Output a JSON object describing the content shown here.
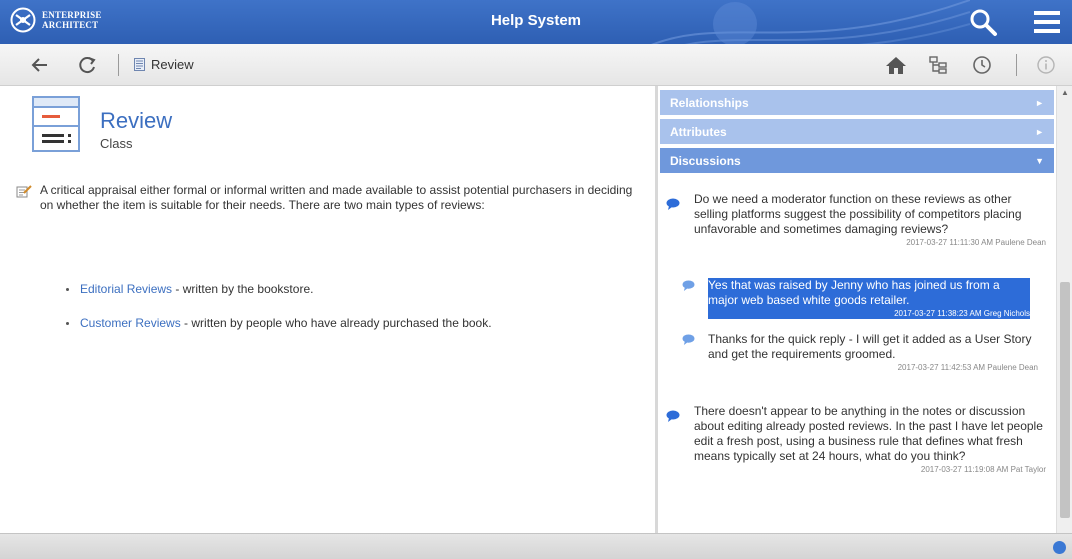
{
  "titlebar": {
    "logo_line1": "ENTERPRISE",
    "logo_line2": "ARCHITECT",
    "title": "Help System",
    "icons": [
      "logo-icon",
      "search-icon",
      "hamburger-menu-icon"
    ]
  },
  "toolbar": {
    "breadcrumb": "Review",
    "icons": [
      "back-arrow-icon",
      "refresh-icon",
      "document-icon",
      "home-icon",
      "hierarchy-icon",
      "history-clock-icon",
      "info-icon"
    ]
  },
  "element": {
    "name": "Review",
    "type": "Class",
    "description": "A critical appraisal either formal or informal written and made available to assist potential purchasers in deciding on whether the item is suitable for their needs. There are two main types of reviews:",
    "bullets": [
      {
        "term": "Editorial Reviews",
        "text": " - written by the bookstore."
      },
      {
        "term": "Customer Reviews",
        "text": " - written by people who have already purchased the book."
      }
    ]
  },
  "panel": {
    "sections": [
      {
        "label": "Relationships",
        "state": "collapsed"
      },
      {
        "label": "Attributes",
        "state": "collapsed"
      },
      {
        "label": "Discussions",
        "state": "expanded"
      }
    ]
  },
  "discussions": [
    {
      "text": "Do we need a moderator function on these reviews as other selling platforms suggest the possibility of competitors placing unfavorable and sometimes damaging reviews?",
      "meta": "2017-03-27 11:11:30 AM   Paulene Dean",
      "replies": [
        {
          "text": "Yes that was raised by Jenny who has joined us from a major web based white goods retailer.",
          "meta": "2017-03-27 11:38:23 AM   Greg Nichols",
          "selected": true
        },
        {
          "text": "Thanks for the quick reply - I will get it added as a User Story and get the requirements groomed.",
          "meta": "2017-03-27 11:42:53 AM   Paulene Dean",
          "selected": false
        }
      ]
    },
    {
      "text": "There doesn't appear to be anything in the notes or discussion about editing already posted reviews. In the past I have let people edit a fresh post, using a business rule that defines what fresh means typically set at 24 hours, what do you think?",
      "meta": "2017-03-27 11:19:08 AM   Pat Taylor",
      "replies": []
    }
  ],
  "colors": {
    "titlebar": "#2e5fb3",
    "accent": "#3c6fc0",
    "accordion_collapsed": "#a9c2ec",
    "accordion_expanded": "#6f98dc",
    "selection": "#2d6cd8"
  }
}
